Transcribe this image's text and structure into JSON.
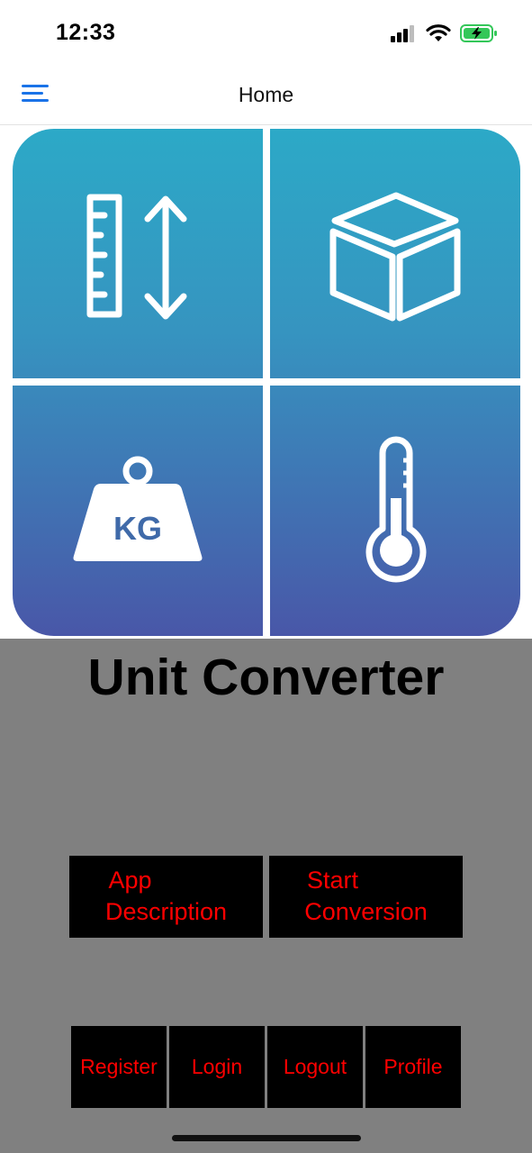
{
  "status_bar": {
    "time": "12:33",
    "icons": [
      "cellular-signal-icon",
      "wifi-icon",
      "battery-charging-icon"
    ],
    "battery_color": "#34c759"
  },
  "nav": {
    "title": "Home",
    "menu_icon": "hamburger-menu-icon",
    "accent": "#1a73e8"
  },
  "hero": {
    "tiles": [
      "ruler-length-icon",
      "cube-volume-icon",
      "weight-kg-icon",
      "thermometer-icon"
    ],
    "weight_label": "KG",
    "gradient_top": "#2ca9c7",
    "gradient_bottom": "#4957a8"
  },
  "main": {
    "title": "Unit Converter",
    "background": "#808080",
    "primary_buttons": [
      {
        "line1": "App",
        "line2": "Description"
      },
      {
        "line1": "Start",
        "line2": "Conversion"
      }
    ],
    "bottom_buttons": [
      "Register",
      "Login",
      "Logout",
      "Profile"
    ],
    "button_text_color": "#ff0000"
  }
}
